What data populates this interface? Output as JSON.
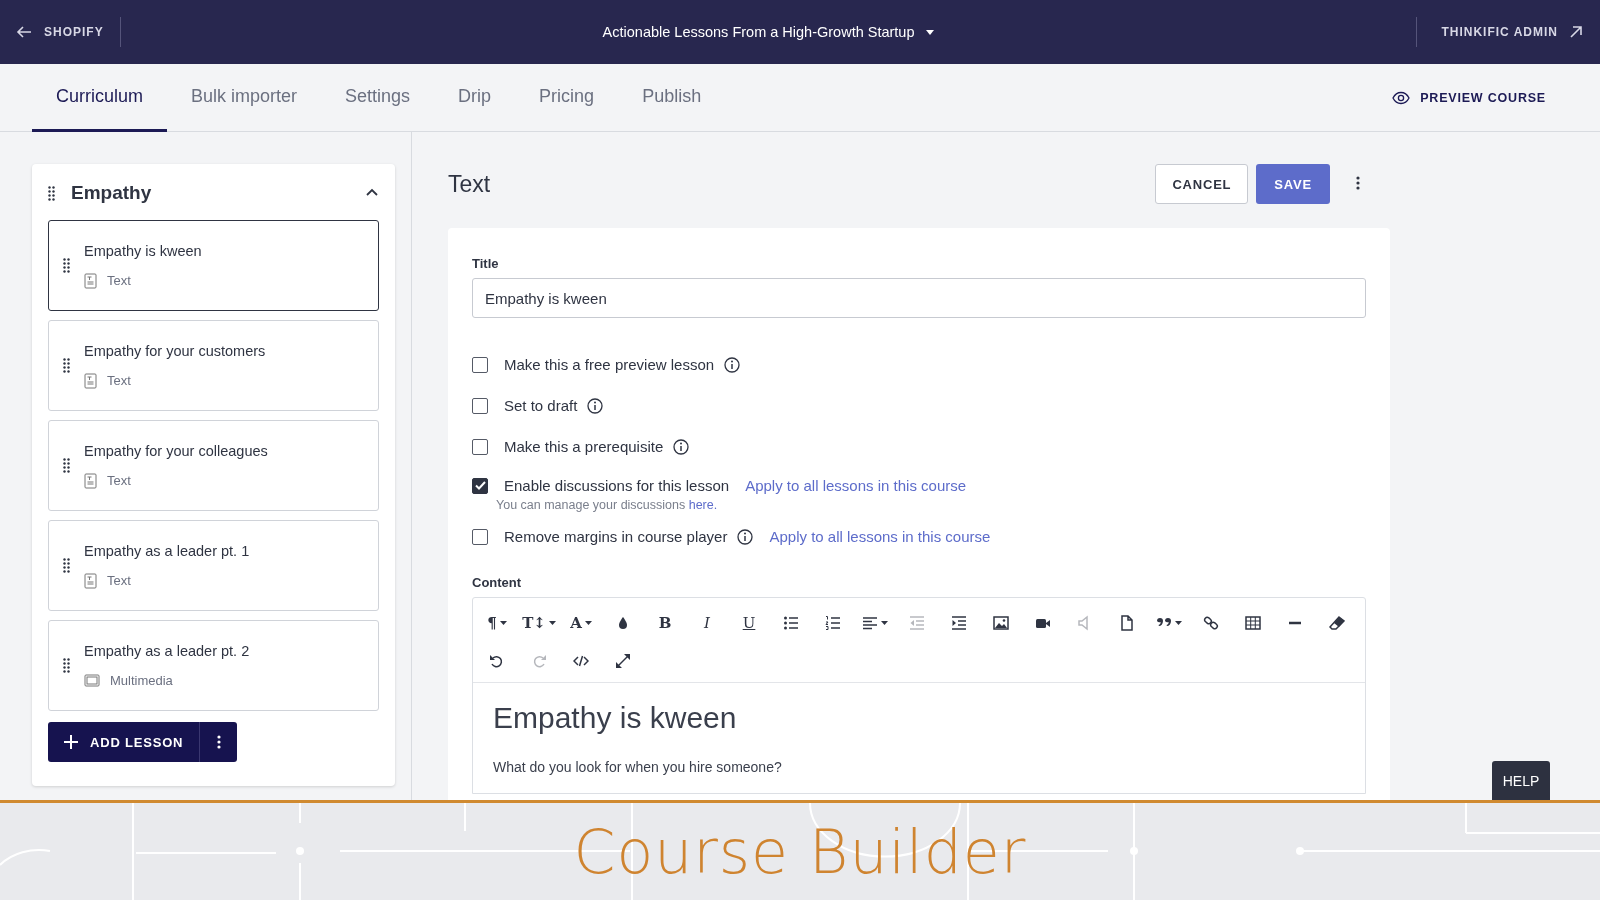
{
  "top_bar": {
    "back_label": "SHOPIFY",
    "course_title": "Actionable Lessons From a High-Growth Startup",
    "admin_link": "THINKIFIC ADMIN"
  },
  "tabs": [
    {
      "label": "Curriculum",
      "selected": true
    },
    {
      "label": "Bulk importer",
      "selected": false
    },
    {
      "label": "Settings",
      "selected": false
    },
    {
      "label": "Drip",
      "selected": false
    },
    {
      "label": "Pricing",
      "selected": false
    },
    {
      "label": "Publish",
      "selected": false
    }
  ],
  "preview_button": "PREVIEW COURSE",
  "chapter": {
    "title": "Empathy",
    "expanded": true,
    "lessons": [
      {
        "title": "Empathy is kween",
        "kind": "text",
        "type_label": "Text",
        "selected": true
      },
      {
        "title": "Empathy for your customers",
        "kind": "text",
        "type_label": "Text",
        "selected": false
      },
      {
        "title": "Empathy for your colleagues",
        "kind": "text",
        "type_label": "Text",
        "selected": false
      },
      {
        "title": "Empathy as a leader pt. 1",
        "kind": "text",
        "type_label": "Text",
        "selected": false
      },
      {
        "title": "Empathy as a leader pt. 2",
        "kind": "multimedia",
        "type_label": "Multimedia",
        "selected": false
      }
    ]
  },
  "add_lesson_button": "ADD LESSON",
  "editor": {
    "heading": "Text",
    "cancel_button": "CANCEL",
    "save_button": "SAVE",
    "title_label": "Title",
    "title_value": "Empathy is kween",
    "options": [
      {
        "label": "Make this a free preview lesson",
        "checked": false,
        "info": true
      },
      {
        "label": "Set to draft",
        "checked": false,
        "info": true
      },
      {
        "label": "Make this a prerequisite",
        "checked": false,
        "info": true
      },
      {
        "label": "Enable discussions for this lesson",
        "checked": true,
        "info": false,
        "apply_link": "Apply to all lessons in this course",
        "note": "You can manage your discussions",
        "note_link": "here."
      },
      {
        "label": "Remove margins in course player",
        "checked": false,
        "info": true,
        "apply_link": "Apply to all lessons in this course"
      }
    ],
    "content_label": "Content",
    "toolbar": [
      {
        "kind": "glyph",
        "glyph": "¶",
        "dropdown": true,
        "disabled": false
      },
      {
        "kind": "glyph",
        "glyph": "T↕",
        "dropdown": true,
        "disabled": false
      },
      {
        "kind": "glyph",
        "glyph": "A",
        "dropdown": true,
        "disabled": false
      },
      {
        "kind": "drop",
        "dropdown": false,
        "disabled": false
      },
      {
        "kind": "bold",
        "glyph": "B",
        "dropdown": false,
        "disabled": false
      },
      {
        "kind": "italic",
        "glyph": "I",
        "dropdown": false,
        "disabled": false
      },
      {
        "kind": "underline",
        "glyph": "U",
        "dropdown": false,
        "disabled": false
      },
      {
        "kind": "bullets",
        "dropdown": false,
        "disabled": false
      },
      {
        "kind": "numbers",
        "dropdown": false,
        "disabled": false
      },
      {
        "kind": "align",
        "dropdown": true,
        "disabled": false
      },
      {
        "kind": "outdent",
        "dropdown": false,
        "disabled": true
      },
      {
        "kind": "indent",
        "dropdown": false,
        "disabled": false
      },
      {
        "kind": "image",
        "dropdown": false,
        "disabled": false
      },
      {
        "kind": "video",
        "dropdown": false,
        "disabled": false
      },
      {
        "kind": "audio",
        "dropdown": false,
        "disabled": true
      },
      {
        "kind": "file",
        "dropdown": false,
        "disabled": false
      },
      {
        "kind": "quote",
        "dropdown": true,
        "disabled": false
      },
      {
        "kind": "link",
        "dropdown": false,
        "disabled": false
      },
      {
        "kind": "table",
        "dropdown": false,
        "disabled": false
      },
      {
        "kind": "rule",
        "dropdown": false,
        "disabled": false
      },
      {
        "kind": "eraser",
        "dropdown": false,
        "disabled": false
      },
      {
        "kind": "undo",
        "dropdown": false,
        "disabled": false
      },
      {
        "kind": "redo",
        "dropdown": false,
        "disabled": true
      },
      {
        "kind": "code",
        "dropdown": false,
        "disabled": false
      },
      {
        "kind": "fullscreen",
        "dropdown": false,
        "disabled": false
      }
    ],
    "content": {
      "heading": "Empathy is kween",
      "paragraph": "What do you look for when you hire someone?"
    }
  },
  "help_button": "HELP",
  "banner": {
    "title": "Course Builder"
  }
}
